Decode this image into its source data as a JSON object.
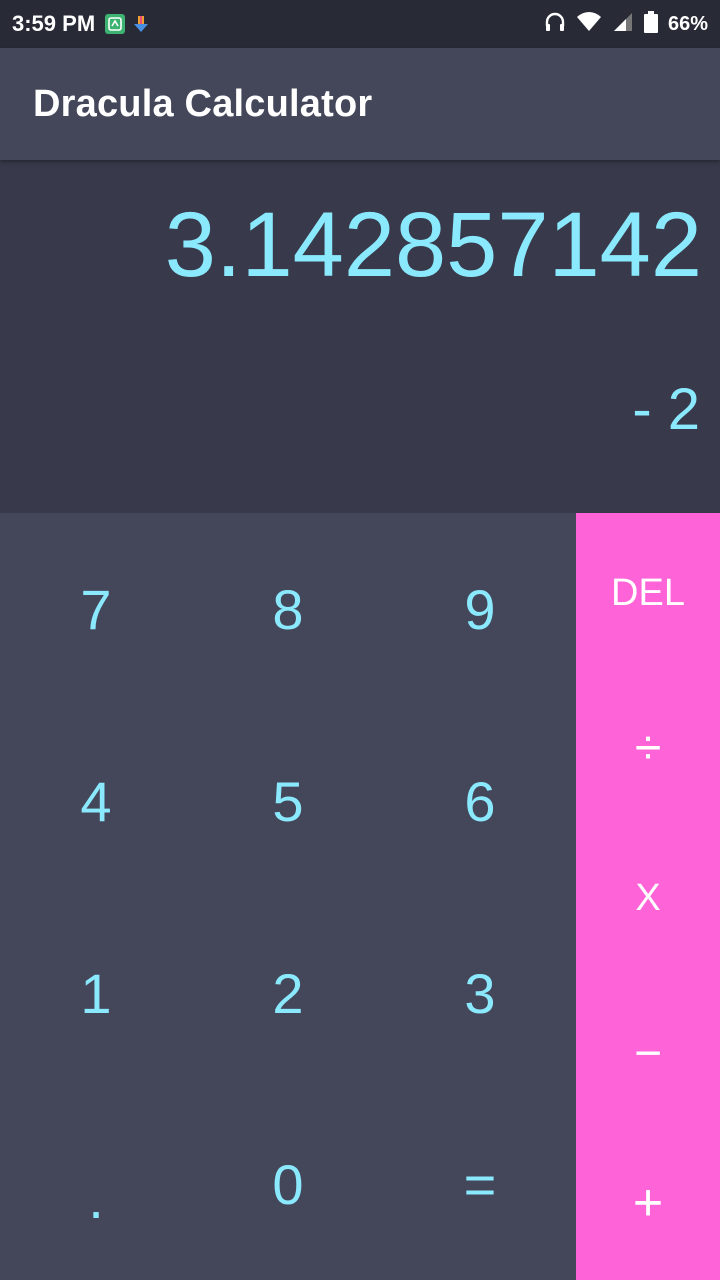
{
  "status_bar": {
    "time": "3:59 PM",
    "battery": "66%",
    "icons": [
      "app-notification-icon",
      "download-icon",
      "headphones-icon",
      "wifi-icon",
      "signal-icon",
      "battery-icon"
    ]
  },
  "app_bar": {
    "title": "Dracula Calculator"
  },
  "display": {
    "result": "3.142857142",
    "expression": "- 2"
  },
  "keypad": {
    "rows": [
      [
        "7",
        "8",
        "9"
      ],
      [
        "4",
        "5",
        "6"
      ],
      [
        "1",
        "2",
        "3"
      ],
      [
        ".",
        "0",
        "="
      ]
    ]
  },
  "operators": {
    "delete": "DEL",
    "divide": "÷",
    "multiply": "X",
    "subtract": "−",
    "add": "+"
  },
  "colors": {
    "background": "#44475a",
    "display_background": "#383a4b",
    "status_bar": "#282a36",
    "accent_text": "#8be9fd",
    "operator_panel": "#ff63d8"
  }
}
